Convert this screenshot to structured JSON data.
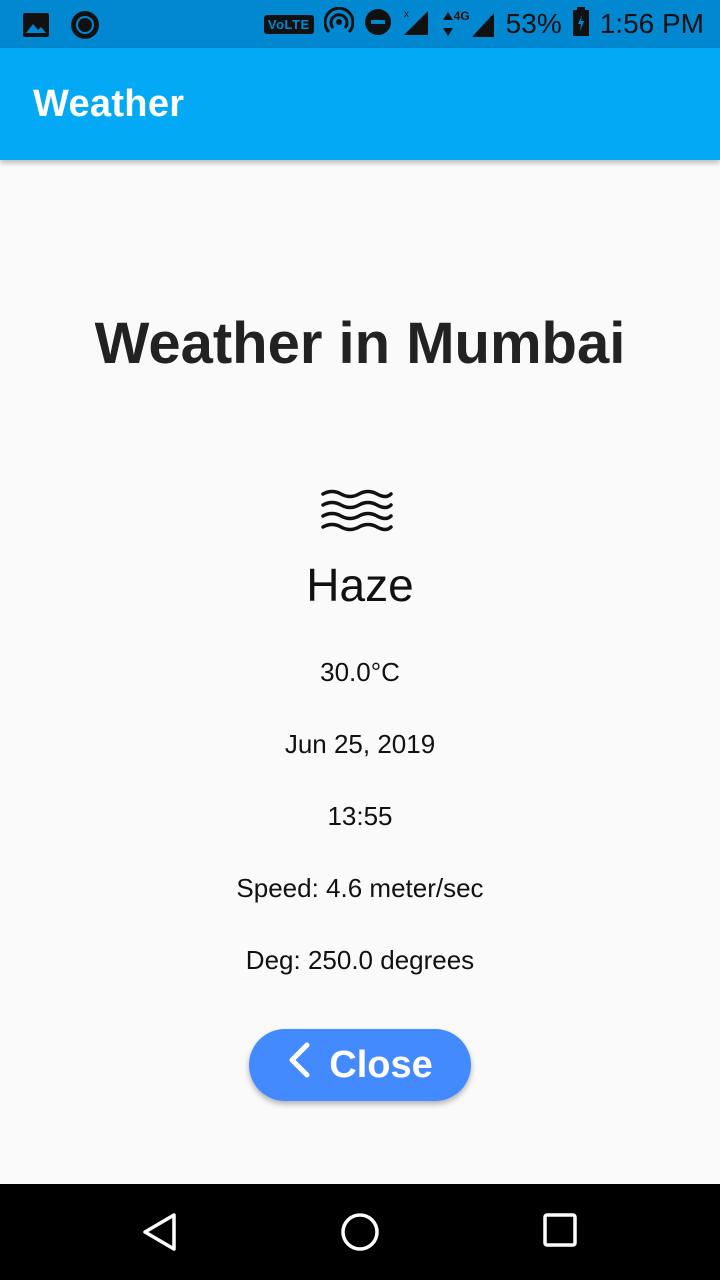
{
  "status_bar": {
    "volte": "VoLTE",
    "network": "4G",
    "battery": "53%",
    "time": "1:56 PM",
    "icons": [
      "image-icon",
      "circle-app-icon",
      "hotspot-icon",
      "do-not-disturb-icon",
      "signal-icon",
      "battery-icon"
    ]
  },
  "app_bar": {
    "title": "Weather"
  },
  "weather": {
    "headline": "Weather in Mumbai",
    "icon": "haze-icon",
    "condition": "Haze",
    "temperature": "30.0°C",
    "date": "Jun 25, 2019",
    "time": "13:55",
    "speed": "Speed: 4.6 meter/sec",
    "deg": "Deg: 250.0 degrees"
  },
  "close_button": {
    "label": "Close",
    "icon": "chevron-left-icon",
    "color": "#448aff"
  },
  "nav_bar": {
    "icons": [
      "back-icon",
      "home-icon",
      "recents-icon"
    ]
  },
  "colors": {
    "status_bar": "#0288d1",
    "app_bar": "#03a9f4",
    "background": "#fafafa"
  }
}
